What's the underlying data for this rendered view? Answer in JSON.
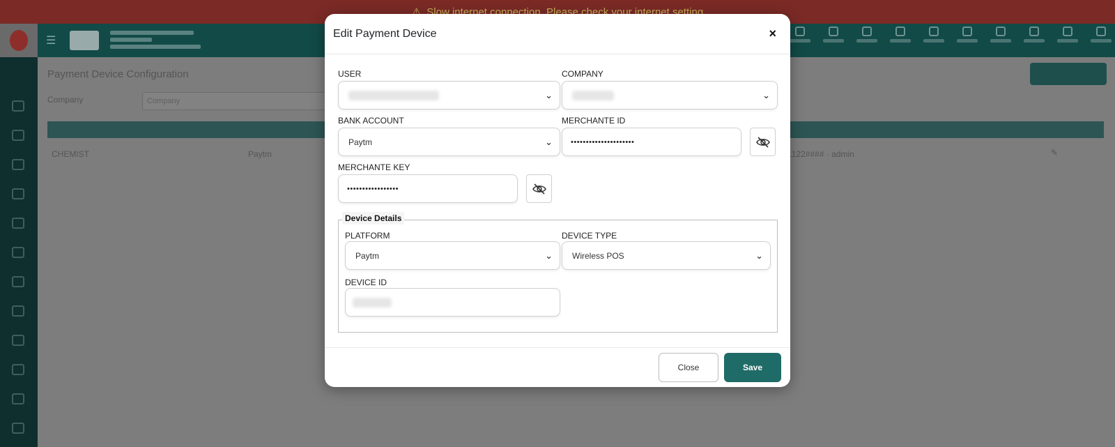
{
  "banner": {
    "message": "Slow internet connection. Please check your internet setting",
    "icon": "wifi-slash-icon"
  },
  "background": {
    "page_title": "Payment Device Configuration",
    "filter_label": "Company",
    "filter_placeholder": "Company",
    "table_row_company": "CHEMIST",
    "table_row_platform": "Paytm",
    "table_row_device": "1122#### · admin"
  },
  "modal": {
    "title": "Edit Payment Device",
    "close_icon": "×",
    "user_label": "USER",
    "company_label": "COMPANY",
    "bank_account_label": "BANK ACCOUNT",
    "bank_account_value": "Paytm",
    "merchant_id_label": "MERCHANTE ID",
    "merchant_id_value": "•••••••••••••••••••••",
    "merchant_key_label": "MERCHANTE KEY",
    "merchant_key_value": "•••••••••••••••••",
    "device_details_legend": "Device Details",
    "platform_label": "PLATFORM",
    "platform_value": "Paytm",
    "device_type_label": "DEVICE TYPE",
    "device_type_value": "Wireless POS",
    "device_id_label": "DEVICE ID",
    "close_button": "Close",
    "save_button": "Save"
  },
  "colors": {
    "primary": "#1f6b67",
    "banner": "#7b2a26",
    "appbar": "#124a47"
  }
}
